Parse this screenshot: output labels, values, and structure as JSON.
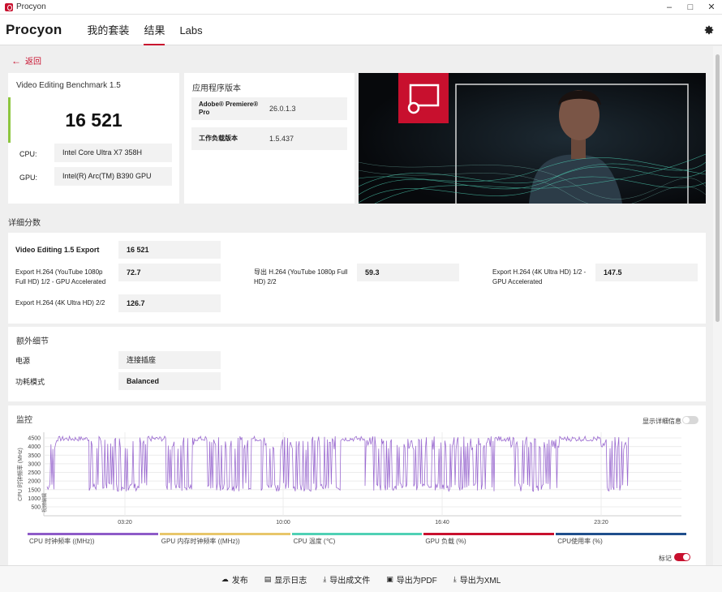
{
  "window": {
    "title": "Procyon"
  },
  "header": {
    "brand": "Procyon",
    "tabs": [
      {
        "label": "我的套装",
        "active": false
      },
      {
        "label": "结果",
        "active": true
      },
      {
        "label": "Labs",
        "active": false
      }
    ]
  },
  "back_label": "返回",
  "score_card": {
    "title": "Video Editing Benchmark 1.5",
    "score": "16 521",
    "cpu_label": "CPU:",
    "cpu_value": "Intel Core Ultra X7 358H",
    "gpu_label": "GPU:",
    "gpu_value": "Intel(R) Arc(TM) B390 GPU"
  },
  "app_card": {
    "title": "应用程序版本",
    "rows": [
      {
        "key": "Adobe® Premiere® Pro",
        "value": "26.0.1.3"
      },
      {
        "key": "工作负载版本",
        "value": "1.5.437"
      }
    ]
  },
  "details": {
    "section_title": "详细分数",
    "main_label": "Video Editing 1.5 Export",
    "main_value": "16 521",
    "items": [
      {
        "label": "Export H.264 (YouTube 1080p Full HD) 1/2 - GPU Accelerated",
        "value": "72.7"
      },
      {
        "label": "导出 H.264 (YouTube 1080p Full HD) 2/2",
        "value": "59.3"
      },
      {
        "label": "Export H.264 (4K Ultra HD) 1/2 - GPU Accelerated",
        "value": "147.5"
      },
      {
        "label": "Export H.264 (4K Ultra HD) 2/2",
        "value": "126.7"
      }
    ]
  },
  "extra": {
    "title": "额外细节",
    "rows": [
      {
        "label": "电源",
        "value": "连接插座"
      },
      {
        "label": "功耗模式",
        "value": "Balanced"
      }
    ]
  },
  "monitor": {
    "title": "监控",
    "show_details_label": "显示详细信息",
    "show_details_on": false,
    "ylabel": "CPU 时钟频率 (MHz)",
    "yticks": [
      "4500",
      "4000",
      "3500",
      "3000",
      "2500",
      "2000",
      "1500",
      "1000",
      "500"
    ],
    "xticks": [
      "03:20",
      "10:00",
      "16:40",
      "23:20"
    ],
    "marker_text": "视频编辑",
    "legend": [
      {
        "label": "CPU 时钟频率 ((MHz))",
        "color": "#8e5bc8"
      },
      {
        "label": "GPU 内存时钟频率 ((MHz))",
        "color": "#e8c66a"
      },
      {
        "label": "CPU 温度 (℃)",
        "color": "#4fd1b5"
      },
      {
        "label": "GPU 负载 (%)",
        "color": "#c8102e"
      },
      {
        "label": "CPU使用率 (%)",
        "color": "#1f4e8c"
      }
    ],
    "markers_label": "标记",
    "markers_on": true,
    "line_color": "#9b6bd0"
  },
  "footer": {
    "buttons": [
      {
        "label": "发布",
        "icon": "cloud-upload-icon"
      },
      {
        "label": "显示日志",
        "icon": "document-icon"
      },
      {
        "label": "导出成文件",
        "icon": "download-icon"
      },
      {
        "label": "导出为PDF",
        "icon": "save-icon"
      },
      {
        "label": "导出为XML",
        "icon": "download-icon"
      }
    ]
  },
  "accent_color": "#c8102e"
}
